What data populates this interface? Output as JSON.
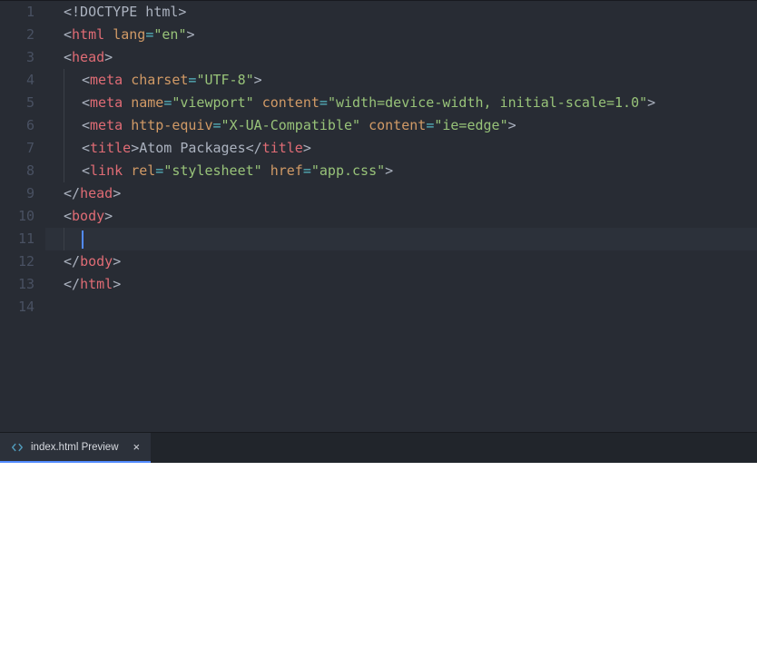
{
  "editor": {
    "lines": [
      1,
      2,
      3,
      4,
      5,
      6,
      7,
      8,
      9,
      10,
      11,
      12,
      13,
      14
    ],
    "activeLine": 11,
    "code": {
      "l1": {
        "doctype": "<!DOCTYPE html>"
      },
      "l2": {
        "open": "<",
        "tag": "html",
        "sp": " ",
        "attr": "lang",
        "eq": "=",
        "q1": "\"",
        "val": "en",
        "q2": "\"",
        "close": ">"
      },
      "l3": {
        "open": "<",
        "tag": "head",
        "close": ">"
      },
      "l4": {
        "open": "<",
        "tag": "meta",
        "sp": " ",
        "attr": "charset",
        "eq": "=",
        "q1": "\"",
        "val": "UTF-8",
        "q2": "\"",
        "close": ">"
      },
      "l5": {
        "open": "<",
        "tag": "meta",
        "sp": " ",
        "attr1": "name",
        "eq1": "=",
        "q1a": "\"",
        "val1": "viewport",
        "q1b": "\"",
        "sp2": " ",
        "attr2": "content",
        "eq2": "=",
        "q2a": "\"",
        "val2": "width=device-width, initial-scale=1.0",
        "q2b": "\"",
        "close": ">"
      },
      "l6": {
        "open": "<",
        "tag": "meta",
        "sp": " ",
        "attr1": "http-equiv",
        "eq1": "=",
        "q1a": "\"",
        "val1": "X-UA-Compatible",
        "q1b": "\"",
        "sp2": " ",
        "attr2": "content",
        "eq2": "=",
        "q2a": "\"",
        "val2": "ie=edge",
        "q2b": "\"",
        "close": ">"
      },
      "l7": {
        "open": "<",
        "tag": "title",
        "close1": ">",
        "text": "Atom Packages",
        "open2": "</",
        "tag2": "title",
        "close2": ">"
      },
      "l8": {
        "open": "<",
        "tag": "link",
        "sp": " ",
        "attr1": "rel",
        "eq1": "=",
        "q1a": "\"",
        "val1": "stylesheet",
        "q1b": "\"",
        "sp2": " ",
        "attr2": "href",
        "eq2": "=",
        "q2a": "\"",
        "val2": "app.css",
        "q2b": "\"",
        "close": ">"
      },
      "l9": {
        "open": "</",
        "tag": "head",
        "close": ">"
      },
      "l10": {
        "open": "<",
        "tag": "body",
        "close": ">"
      },
      "l12": {
        "open": "</",
        "tag": "body",
        "close": ">"
      },
      "l13": {
        "open": "</",
        "tag": "html",
        "close": ">"
      }
    }
  },
  "tab": {
    "title": "index.html Preview",
    "close": "×"
  }
}
